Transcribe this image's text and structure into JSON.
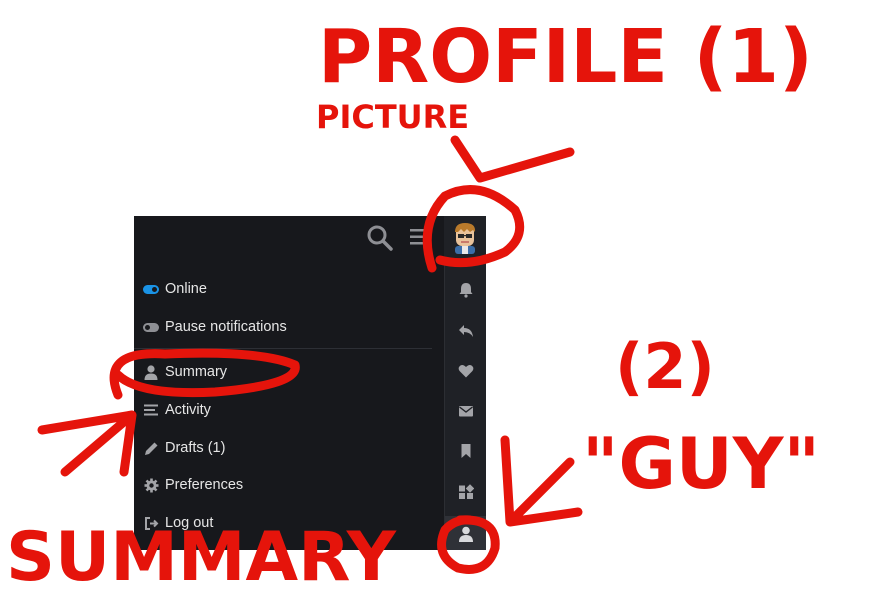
{
  "header": {
    "search_icon": "search-icon",
    "menu_icon": "hamburger-icon",
    "avatar_icon": "avatar-icon"
  },
  "menu": {
    "items": [
      {
        "label": "Online",
        "icon": "toggle-on-icon"
      },
      {
        "label": "Pause notifications",
        "icon": "toggle-off-icon"
      },
      {
        "label": "Summary",
        "icon": "user-icon"
      },
      {
        "label": "Activity",
        "icon": "list-icon"
      },
      {
        "label": "Drafts (1)",
        "icon": "pencil-icon"
      },
      {
        "label": "Preferences",
        "icon": "gear-icon"
      },
      {
        "label": "Log out",
        "icon": "logout-icon"
      }
    ]
  },
  "rail": {
    "items": [
      "bell-icon",
      "reply-icon",
      "heart-icon",
      "envelope-icon",
      "bookmark-icon",
      "grid-icon",
      "user-icon"
    ]
  },
  "annotations": {
    "profile_title": "PROFILE (1)",
    "picture": "PICTURE",
    "summary": "SUMMARY",
    "number_two": "(2)",
    "guy": "\"GUY\""
  },
  "colors": {
    "panel_bg": "#17181c",
    "rail_bg": "#1f2126",
    "accent_toggle": "#1a93e6",
    "annotation_red": "#e5140b"
  }
}
